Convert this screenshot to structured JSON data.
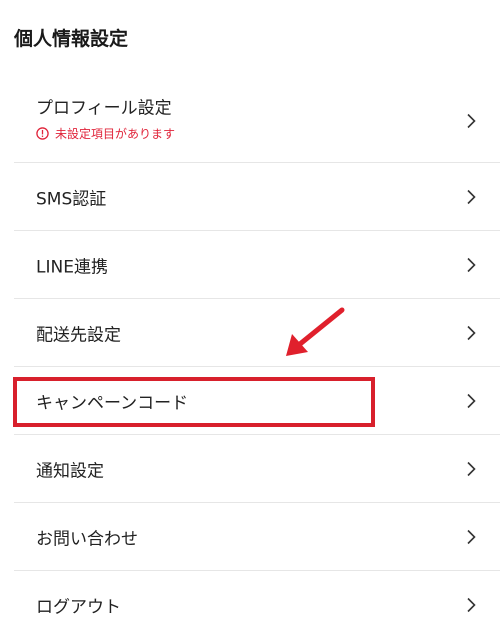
{
  "page": {
    "title": "個人情報設定"
  },
  "menu": {
    "items": [
      {
        "label": "プロフィール設定",
        "warning": "未設定項目があります"
      },
      {
        "label": "SMS認証"
      },
      {
        "label": "LINE連携"
      },
      {
        "label": "配送先設定"
      },
      {
        "label": "キャンペーンコード"
      },
      {
        "label": "通知設定"
      },
      {
        "label": "お問い合わせ"
      },
      {
        "label": "ログアウト"
      }
    ]
  },
  "annotation": {
    "highlight_color": "#d8202c",
    "highlighted_item": "キャンペーンコード"
  },
  "colors": {
    "warning": "#e0243a",
    "divider": "#e6e6e6",
    "text": "#222222"
  },
  "icons": {
    "chevron": "chevron-right-icon",
    "warning": "exclamation-circle-icon",
    "annotation": "red-arrow-icon"
  }
}
